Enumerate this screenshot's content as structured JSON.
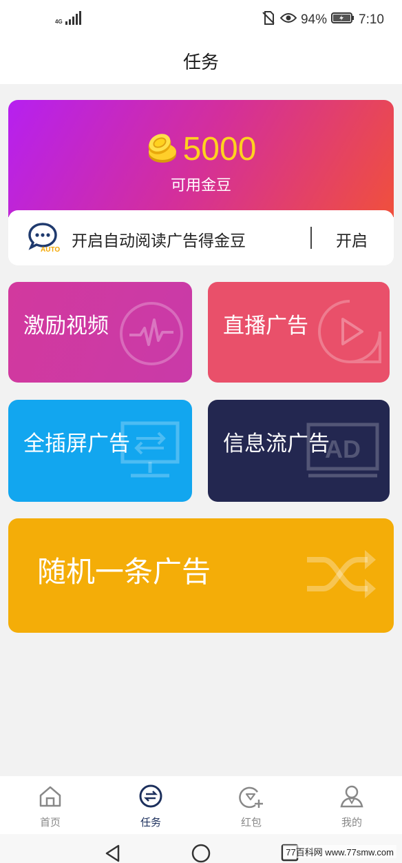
{
  "status_bar": {
    "network": "4G",
    "battery_percent": "94%",
    "time": "7:10",
    "icons": [
      "signal-icon",
      "no-sim-icon",
      "eye-icon",
      "battery-icon"
    ]
  },
  "header": {
    "title": "任务"
  },
  "coin_card": {
    "amount": "5000",
    "label": "可用金豆",
    "coin_color": "#ffd21f",
    "gradient": [
      "#b620f0",
      "#f0503c"
    ]
  },
  "auto_read": {
    "badge": "AUTO",
    "text": "开启自动阅读广告得金豆",
    "button_label": "开启"
  },
  "tiles": [
    {
      "label": "激励视频",
      "icon": "pulse-icon",
      "color": "#d2399e"
    },
    {
      "label": "直播广告",
      "icon": "play-icon",
      "color": "#e9506a"
    },
    {
      "label": "全插屏广告",
      "icon": "monitor-icon",
      "color": "#12a6ef"
    },
    {
      "label": "信息流广告",
      "icon": "ad-screen-icon",
      "color": "#232750"
    },
    {
      "label": "随机一条广告",
      "icon": "shuffle-icon",
      "color": "#f4ad08"
    }
  ],
  "bottom_nav": [
    {
      "label": "首页",
      "icon": "home-icon",
      "active": false
    },
    {
      "label": "任务",
      "icon": "exchange-icon",
      "active": true
    },
    {
      "label": "红包",
      "icon": "red-packet-icon",
      "active": false
    },
    {
      "label": "我的",
      "icon": "user-icon",
      "active": false
    }
  ],
  "system_nav": {
    "icons": [
      "back-icon",
      "home-circle-icon",
      "recents-icon"
    ],
    "watermark": "77百科网 www.77smw.com"
  }
}
